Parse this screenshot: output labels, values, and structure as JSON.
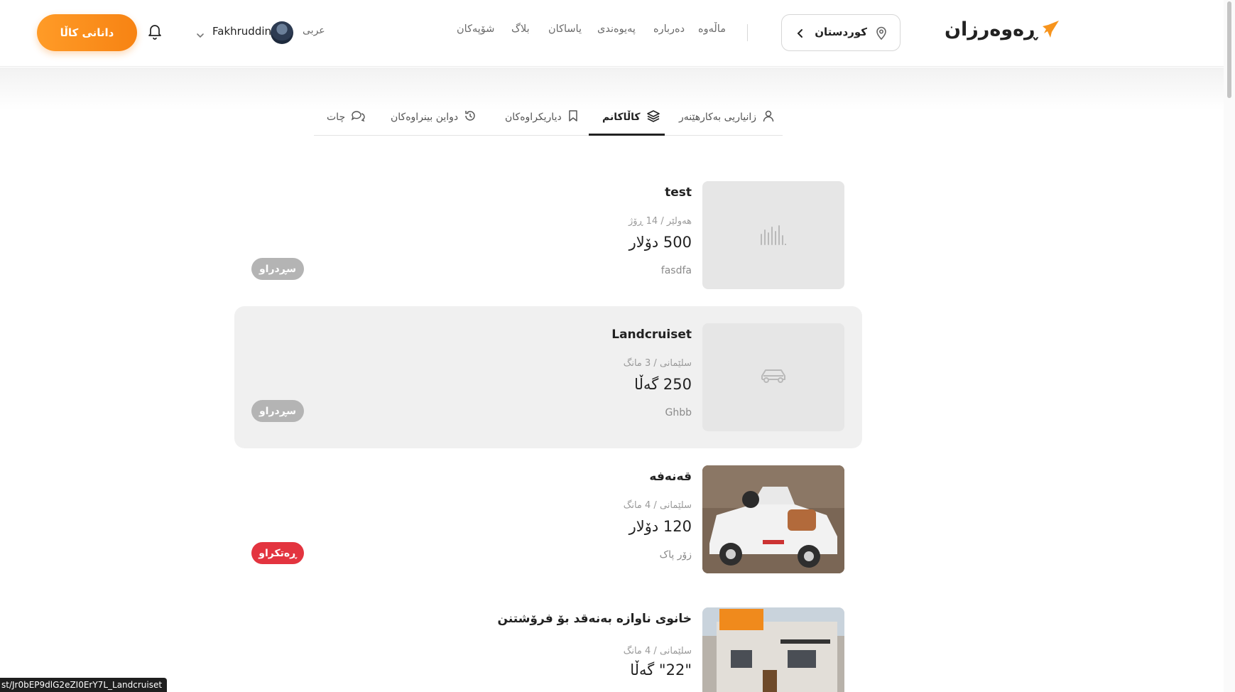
{
  "header": {
    "logo_text": "ڕەوەرزان",
    "location": "كوردستان",
    "nav": [
      "ماڵەوە",
      "دەربارە",
      "پەیوەندی",
      "یاساکان",
      "بلاگ",
      "شۆپەکان"
    ],
    "language": "عربی",
    "username": "Fakhruddin",
    "cta_label": "دانانی کاڵا",
    "accent_color": "#f78313"
  },
  "tabs": [
    {
      "label": "زانیاریی بەکارهێنەر",
      "icon": "user-icon"
    },
    {
      "label": "کاڵاکانم",
      "icon": "layers-icon",
      "active": true
    },
    {
      "label": "دیاریکراوەکان",
      "icon": "bookmark-icon"
    },
    {
      "label": "دواین بینراوەکان",
      "icon": "history-icon"
    },
    {
      "label": "چات",
      "icon": "chat-icon"
    }
  ],
  "listings": [
    {
      "title": "test",
      "meta": "هەولێر / 14 ڕۆژ",
      "price": "500 دۆلار",
      "desc": "fasdfa",
      "badge": "سڕدراو",
      "badge_color": "#b4b4b4",
      "thumb": "building-placeholder-icon"
    },
    {
      "title": "Landcruiset",
      "meta": "سلێمانی / 3 مانگ",
      "price": "250 گەڵا",
      "desc": "Ghbb",
      "badge": "سڕدراو",
      "badge_color": "#b4b4b4",
      "thumb": "car-placeholder-icon"
    },
    {
      "title": "قەنەفە",
      "meta": "سلێمانی / 4 مانگ",
      "price": "120 دۆلار",
      "desc": "زۆر پاک",
      "badge": "ڕەتکراو",
      "badge_color": "#e3343f",
      "thumb": "toy-car-photo"
    },
    {
      "title": "خانوی ناوازە بەنەقد بۆ فرۆشتنن",
      "meta": "سلێمانی / 4 مانگ",
      "price": "\"22\" گەڵا",
      "desc": "",
      "badge": "",
      "thumb": "house-photo"
    }
  ],
  "status_url": "st/Jr0bEP9dlG2eZI0ErY7L_Landcruiset"
}
